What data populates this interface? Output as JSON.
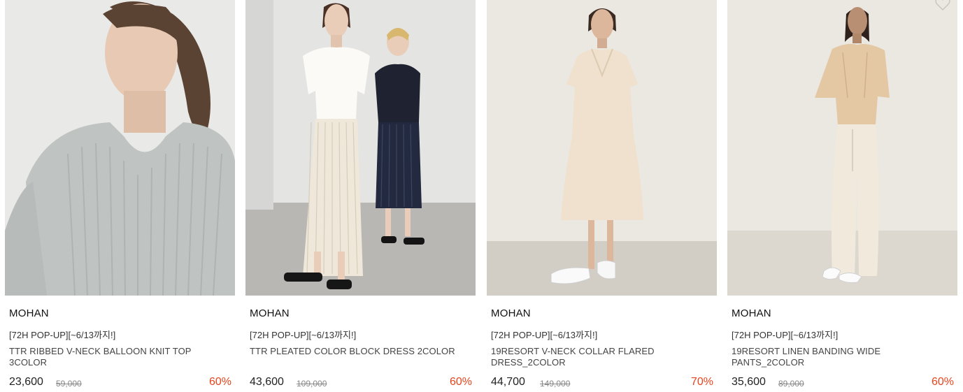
{
  "products": [
    {
      "brand": "MOHAN",
      "promo": "[72H POP-UP][~6/13까지!]",
      "name": "TTR RIBBED V-NECK BALLOON KNIT TOP 3COLOR",
      "price": "23,600",
      "original_price": "59,000",
      "discount": "60%",
      "image_icon": "gray-ribbed-knit-top-photo",
      "bg_color": "#e9e9e7"
    },
    {
      "brand": "MOHAN",
      "promo": "[72H POP-UP][~6/13까지!]",
      "name": "TTR PLEATED COLOR BLOCK DRESS 2COLOR",
      "price": "43,600",
      "original_price": "109,000",
      "discount": "60%",
      "image_icon": "pleated-dress-two-models-photo",
      "bg_color": "#e4e4e2"
    },
    {
      "brand": "MOHAN",
      "promo": "[72H POP-UP][~6/13까지!]",
      "name": "19RESORT V-NECK COLLAR FLARED DRESS_2COLOR",
      "price": "44,700",
      "original_price": "149,000",
      "discount": "70%",
      "image_icon": "beige-flared-dress-photo",
      "bg_color": "#ebe7e1"
    },
    {
      "brand": "MOHAN",
      "promo": "[72H POP-UP][~6/13까지!]",
      "name": "19RESORT LINEN BANDING WIDE PANTS_2COLOR",
      "price": "35,600",
      "original_price": "89,000",
      "discount": "60%",
      "image_icon": "linen-wide-pants-photo",
      "bg_color": "#ebe7e1"
    }
  ],
  "colors": {
    "discount": "#e8451e",
    "price": "#222222",
    "original_price": "#888888"
  }
}
